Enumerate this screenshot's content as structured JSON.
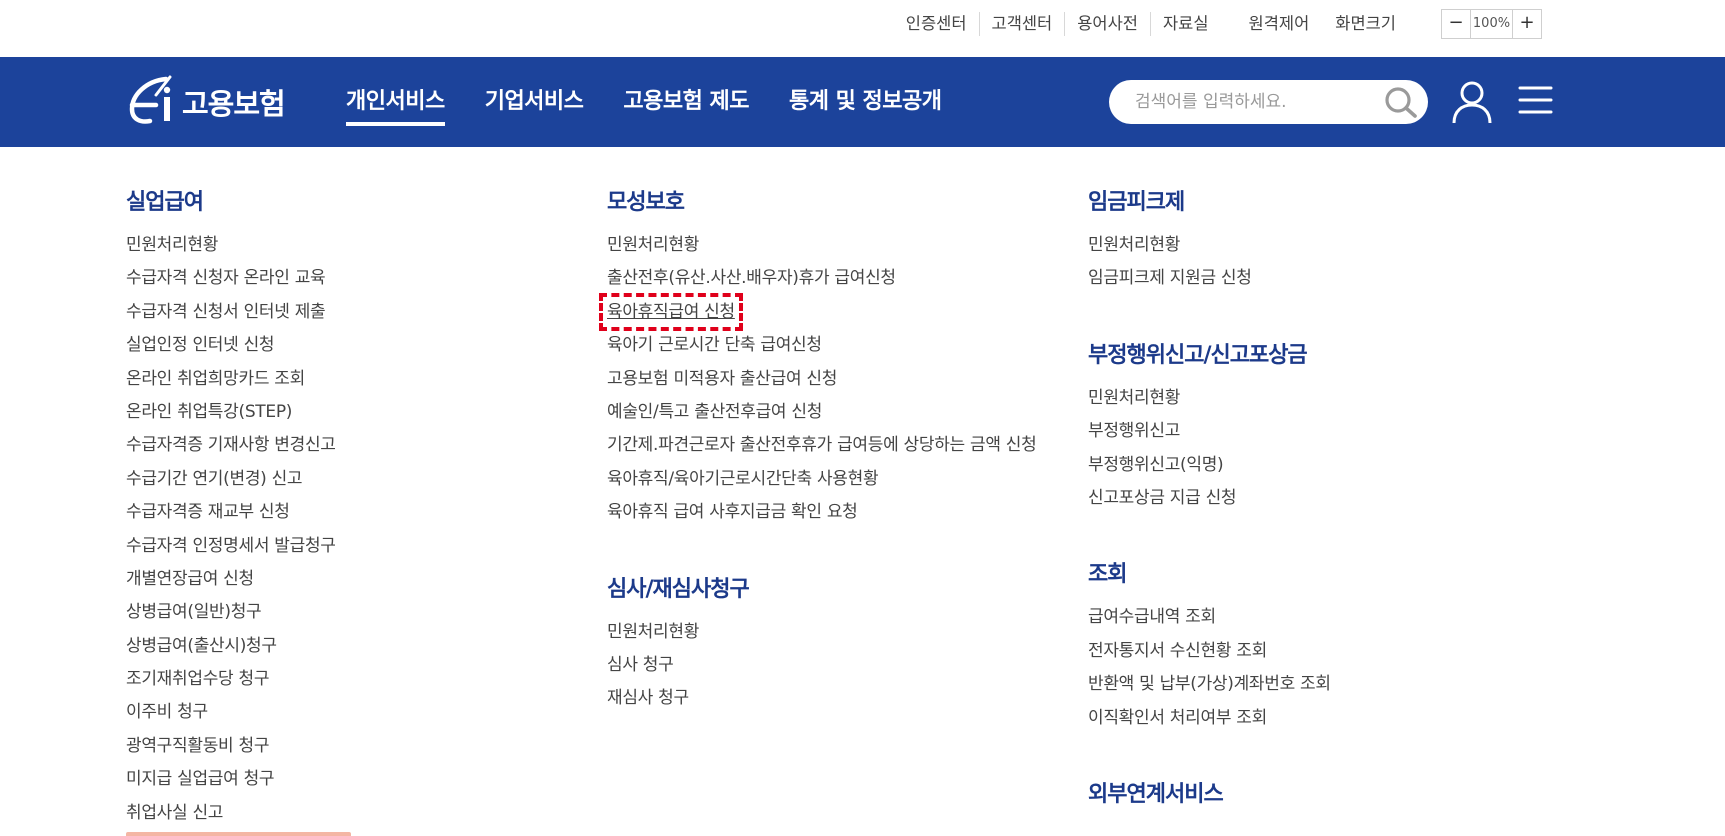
{
  "util": {
    "links": [
      "인증센터",
      "고객센터",
      "용어사전",
      "자료실"
    ],
    "remote": "원격제어",
    "zoom_label": "화면크기",
    "zoom_minus": "−",
    "zoom_value": "100%",
    "zoom_plus": "+"
  },
  "header": {
    "logo_text": "고용보험",
    "nav": [
      "개인서비스",
      "기업서비스",
      "고용보험 제도",
      "통계 및 정보공개"
    ],
    "active_nav": 0,
    "search_placeholder": "검색어를 입력하세요."
  },
  "menu": {
    "col1": [
      {
        "title": "실업급여",
        "items": [
          "민원처리현황",
          "수급자격 신청자 온라인 교육",
          "수급자격 신청서 인터넷 제출",
          "실업인정 인터넷 신청",
          "온라인 취업희망카드 조회",
          "온라인 취업특강(STEP)",
          "수급자격증 기재사항 변경신고",
          "수급기간 연기(변경) 신고",
          "수급자격증 재교부 신청",
          "수급자격 인정명세서 발급청구",
          "개별연장급여 신청",
          "상병급여(일반)청구",
          "상병급여(출산시)청구",
          "조기재취업수당 청구",
          "이주비 청구",
          "광역구직활동비 청구",
          "미지급 실업급여 청구",
          "취업사실 신고"
        ]
      }
    ],
    "col2": [
      {
        "title": "모성보호",
        "items": [
          "민원처리현황",
          "출산전후(유산.사산.배우자)휴가 급여신청",
          "육아휴직급여 신청",
          "육아기 근로시간 단축 급여신청",
          "고용보험 미적용자 출산급여 신청",
          "예술인/특고 출산전후급여 신청",
          "기간제.파견근로자 출산전후휴가 급여등에 상당하는 금액 신청",
          "육아휴직/육아기근로시간단축 사용현황",
          "육아휴직 급여 사후지급금 확인 요청"
        ]
      },
      {
        "title": "심사/재심사청구",
        "items": [
          "민원처리현황",
          "심사 청구",
          "재심사 청구"
        ]
      }
    ],
    "col3": [
      {
        "title": "임금피크제",
        "items": [
          "민원처리현황",
          "임금피크제 지원금 신청"
        ]
      },
      {
        "title": "부정행위신고/신고포상금",
        "items": [
          "민원처리현황",
          "부정행위신고",
          "부정행위신고(익명)",
          "신고포상금 지급 신청"
        ]
      },
      {
        "title": "조회",
        "items": [
          "급여수급내역 조회",
          "전자통지서 수신현황 조회",
          "반환액 및 납부(가상)계좌번호 조회",
          "이직확인서 처리여부 조회"
        ]
      },
      {
        "title": "외부연계서비스",
        "items": []
      }
    ]
  },
  "highlighted_item": "육아휴직급여 신청",
  "colors": {
    "brand_blue": "#1c439b",
    "section_title": "#1c3a8a",
    "highlight_red": "#e0001b"
  }
}
